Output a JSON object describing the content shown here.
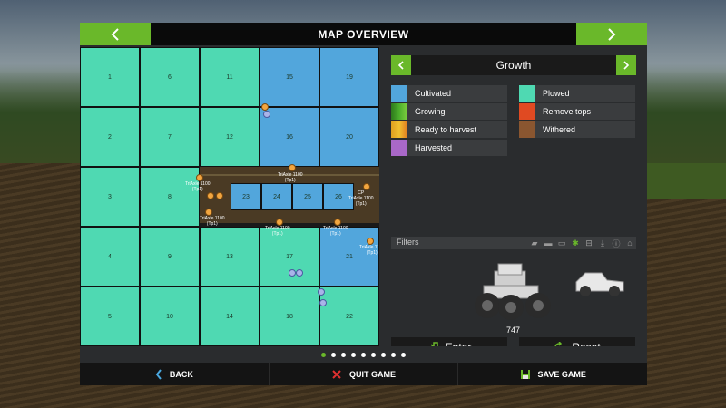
{
  "header": {
    "title": "MAP OVERVIEW",
    "prev_icon": "chevron-left-icon",
    "next_icon": "chevron-right-icon"
  },
  "map": {
    "fields": [
      {
        "id": "1",
        "state": "plowed"
      },
      {
        "id": "6",
        "state": "plowed"
      },
      {
        "id": "11",
        "state": "plowed"
      },
      {
        "id": "15",
        "state": "cultivated"
      },
      {
        "id": "19",
        "state": "cultivated"
      },
      {
        "id": "2",
        "state": "plowed"
      },
      {
        "id": "7",
        "state": "plowed"
      },
      {
        "id": "12",
        "state": "plowed"
      },
      {
        "id": "16",
        "state": "cultivated"
      },
      {
        "id": "20",
        "state": "cultivated"
      },
      {
        "id": "3",
        "state": "plowed"
      },
      {
        "id": "8",
        "state": "plowed"
      },
      {
        "id": "23",
        "state": "cultivated"
      },
      {
        "id": "24",
        "state": "cultivated"
      },
      {
        "id": "25",
        "state": "cultivated"
      },
      {
        "id": "26",
        "state": "cultivated"
      },
      {
        "id": "4",
        "state": "plowed"
      },
      {
        "id": "9",
        "state": "plowed"
      },
      {
        "id": "13",
        "state": "plowed"
      },
      {
        "id": "17",
        "state": "plowed"
      },
      {
        "id": "21",
        "state": "cultivated"
      },
      {
        "id": "5",
        "state": "plowed"
      },
      {
        "id": "10",
        "state": "plowed"
      },
      {
        "id": "14",
        "state": "plowed"
      },
      {
        "id": "18",
        "state": "plowed"
      },
      {
        "id": "22",
        "state": "plowed"
      }
    ],
    "vehicle_labels": {
      "t1": "TriAxle 1100\n(Tp1)",
      "t2": "TriAxle 1100\n(Tp1)",
      "t3": "TriAxle 1100\n(Tp1)",
      "t4": "TriAxle 1100\n(Tp1)",
      "t5": "TriAxle 1100\n(Tp1)",
      "t6": "TriAxle 1100\n(Tp1)",
      "t7": "CP\nTriAxle 1100\n(Tp1)"
    }
  },
  "side": {
    "selector": {
      "label": "Growth"
    },
    "legend": [
      {
        "label": "Cultivated",
        "color": "#52a6dc"
      },
      {
        "label": "Plowed",
        "color": "#4fd9b2"
      },
      {
        "label": "Growing",
        "color": "#4cae2c"
      },
      {
        "label": "Remove tops",
        "color": "#e04a22"
      },
      {
        "label": "Ready to harvest",
        "color": "#f0a020"
      },
      {
        "label": "Withered",
        "color": "#8a5630"
      },
      {
        "label": "Harvested",
        "color": "#a968c8"
      }
    ],
    "filters_label": "Filters",
    "vehicle_count": "747",
    "enter_label": "Enter",
    "reset_label": "Reset"
  },
  "pager": {
    "pages": 9,
    "active": 0
  },
  "footer": {
    "back_label": "BACK",
    "quit_label": "QUIT GAME",
    "save_label": "SAVE GAME"
  }
}
